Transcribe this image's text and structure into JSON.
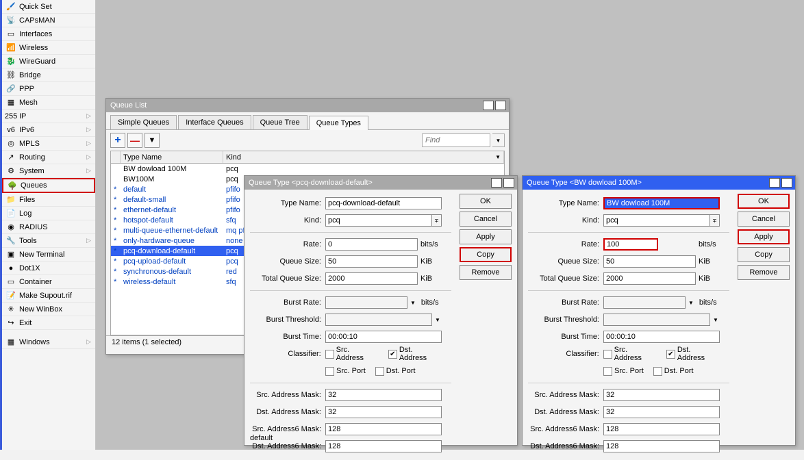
{
  "sidebar": {
    "items": [
      {
        "label": "Quick Set",
        "icon": "🖌️",
        "hl": false
      },
      {
        "label": "CAPsMAN",
        "icon": "📡",
        "hl": false
      },
      {
        "label": "Interfaces",
        "icon": "▭",
        "hl": false
      },
      {
        "label": "Wireless",
        "icon": "📶",
        "hl": false
      },
      {
        "label": "WireGuard",
        "icon": "🐉",
        "hl": false
      },
      {
        "label": "Bridge",
        "icon": "⛓",
        "hl": false
      },
      {
        "label": "PPP",
        "icon": "🔗",
        "hl": false
      },
      {
        "label": "Mesh",
        "icon": "▦",
        "hl": false
      },
      {
        "label": "IP",
        "icon": "255",
        "arrow": true,
        "hl": false
      },
      {
        "label": "IPv6",
        "icon": "v6",
        "arrow": true,
        "hl": false
      },
      {
        "label": "MPLS",
        "icon": "◎",
        "arrow": true,
        "hl": false
      },
      {
        "label": "Routing",
        "icon": "↗",
        "arrow": true,
        "hl": false
      },
      {
        "label": "System",
        "icon": "⚙",
        "arrow": true,
        "hl": false
      },
      {
        "label": "Queues",
        "icon": "🌳",
        "hl": true
      },
      {
        "label": "Files",
        "icon": "📁",
        "hl": false
      },
      {
        "label": "Log",
        "icon": "📄",
        "hl": false
      },
      {
        "label": "RADIUS",
        "icon": "◉",
        "hl": false
      },
      {
        "label": "Tools",
        "icon": "🔧",
        "arrow": true,
        "hl": false
      },
      {
        "label": "New Terminal",
        "icon": "▣",
        "hl": false
      },
      {
        "label": "Dot1X",
        "icon": "●",
        "hl": false
      },
      {
        "label": "Container",
        "icon": "▭",
        "hl": false
      },
      {
        "label": "Make Supout.rif",
        "icon": "📝",
        "hl": false
      },
      {
        "label": "New WinBox",
        "icon": "✳",
        "hl": false
      },
      {
        "label": "Exit",
        "icon": "↪",
        "hl": false
      }
    ],
    "windows_label": "Windows"
  },
  "queue_list": {
    "title": "Queue List",
    "tabs": [
      "Simple Queues",
      "Interface Queues",
      "Queue Tree",
      "Queue Types"
    ],
    "active_tab": 3,
    "find": "Find",
    "headers": [
      "Type Name",
      "Kind"
    ],
    "rows": [
      {
        "star": "",
        "name": "BW dowload 100M",
        "kind": "pcq",
        "link": false,
        "sel": false
      },
      {
        "star": "",
        "name": "BW100M",
        "kind": "pcq",
        "link": false,
        "sel": false
      },
      {
        "star": "*",
        "name": "default",
        "kind": "pfifo",
        "link": true,
        "sel": false
      },
      {
        "star": "*",
        "name": "default-small",
        "kind": "pfifo",
        "link": true,
        "sel": false
      },
      {
        "star": "*",
        "name": "ethernet-default",
        "kind": "pfifo",
        "link": true,
        "sel": false
      },
      {
        "star": "*",
        "name": "hotspot-default",
        "kind": "sfq",
        "link": true,
        "sel": false
      },
      {
        "star": "*",
        "name": "multi-queue-ethernet-default",
        "kind": "mq pfifo",
        "link": true,
        "sel": false
      },
      {
        "star": "*",
        "name": "only-hardware-queue",
        "kind": "none",
        "link": true,
        "sel": false
      },
      {
        "star": "*",
        "name": "pcq-download-default",
        "kind": "pcq",
        "link": true,
        "sel": true
      },
      {
        "star": "*",
        "name": "pcq-upload-default",
        "kind": "pcq",
        "link": true,
        "sel": false
      },
      {
        "star": "*",
        "name": "synchronous-default",
        "kind": "red",
        "link": true,
        "sel": false
      },
      {
        "star": "*",
        "name": "wireless-default",
        "kind": "sfq",
        "link": true,
        "sel": false
      }
    ],
    "status": "12 items (1 selected)"
  },
  "dialog1": {
    "title": "Queue Type <pcq-download-default>",
    "type_name": "pcq-download-default",
    "kind": "pcq",
    "rate": "0",
    "queue_size": "50",
    "total_queue_size": "2000",
    "burst_rate": "",
    "burst_threshold": "",
    "burst_time": "00:00:10",
    "src_addr": false,
    "dst_addr": true,
    "src_port": false,
    "dst_port": false,
    "src_mask": "32",
    "dst_mask": "32",
    "src6_mask": "128",
    "dst6_mask": "128",
    "footer": "default",
    "labels": {
      "type_name": "Type Name:",
      "kind": "Kind:",
      "rate": "Rate:",
      "qs": "Queue Size:",
      "tqs": "Total Queue Size:",
      "br": "Burst Rate:",
      "bt": "Burst Threshold:",
      "btime": "Burst Time:",
      "cls": "Classifier:",
      "sam": "Src. Address Mask:",
      "dam": "Dst. Address Mask:",
      "sam6": "Src. Address6 Mask:",
      "dam6": "Dst. Address6 Mask:",
      "bits": "bits/s",
      "kib": "KiB",
      "sa": "Src. Address",
      "da": "Dst. Address",
      "sp": "Src. Port",
      "dp": "Dst. Port"
    },
    "buttons": {
      "ok": "OK",
      "cancel": "Cancel",
      "apply": "Apply",
      "copy": "Copy",
      "remove": "Remove"
    }
  },
  "dialog2": {
    "title": "Queue Type <BW dowload 100M>",
    "type_name": "BW dowload 100M",
    "kind": "pcq",
    "rate": "100",
    "queue_size": "50",
    "total_queue_size": "2000",
    "burst_rate": "",
    "burst_threshold": "",
    "burst_time": "00:00:10",
    "src_addr": false,
    "dst_addr": true,
    "src_port": false,
    "dst_port": false,
    "src_mask": "32",
    "dst_mask": "32",
    "src6_mask": "128",
    "dst6_mask": "128"
  }
}
